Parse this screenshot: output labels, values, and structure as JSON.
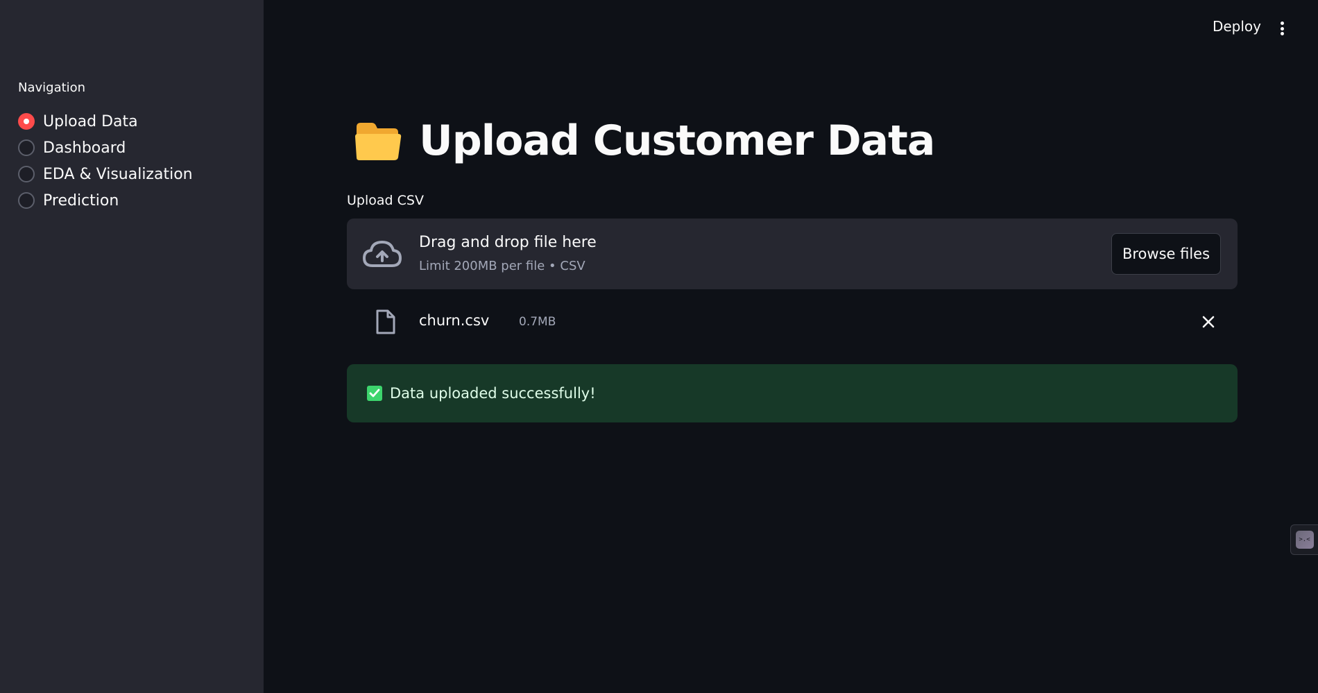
{
  "sidebar": {
    "nav_title": "Navigation",
    "items": [
      {
        "label": "Upload Data",
        "selected": true
      },
      {
        "label": "Dashboard",
        "selected": false
      },
      {
        "label": "EDA & Visualization",
        "selected": false
      },
      {
        "label": "Prediction",
        "selected": false
      }
    ]
  },
  "header": {
    "deploy_label": "Deploy",
    "menu_icon": "vertical-dots-icon"
  },
  "main": {
    "title_icon": "folder-icon",
    "title": "Upload Customer Data",
    "upload": {
      "label": "Upload CSV",
      "drop_text": "Drag and drop file here",
      "limit_text": "Limit 200MB per file • CSV",
      "browse_label": "Browse files"
    },
    "file": {
      "name": "churn.csv",
      "size": "0.7MB"
    },
    "alert": {
      "text": "Data uploaded successfully!"
    }
  },
  "colors": {
    "background": "#0e1117",
    "sidebar": "#262730",
    "accent": "#ff4b4b",
    "success_bg": "#173928",
    "success_text": "#dffde9",
    "check_green": "#3dd56d"
  }
}
